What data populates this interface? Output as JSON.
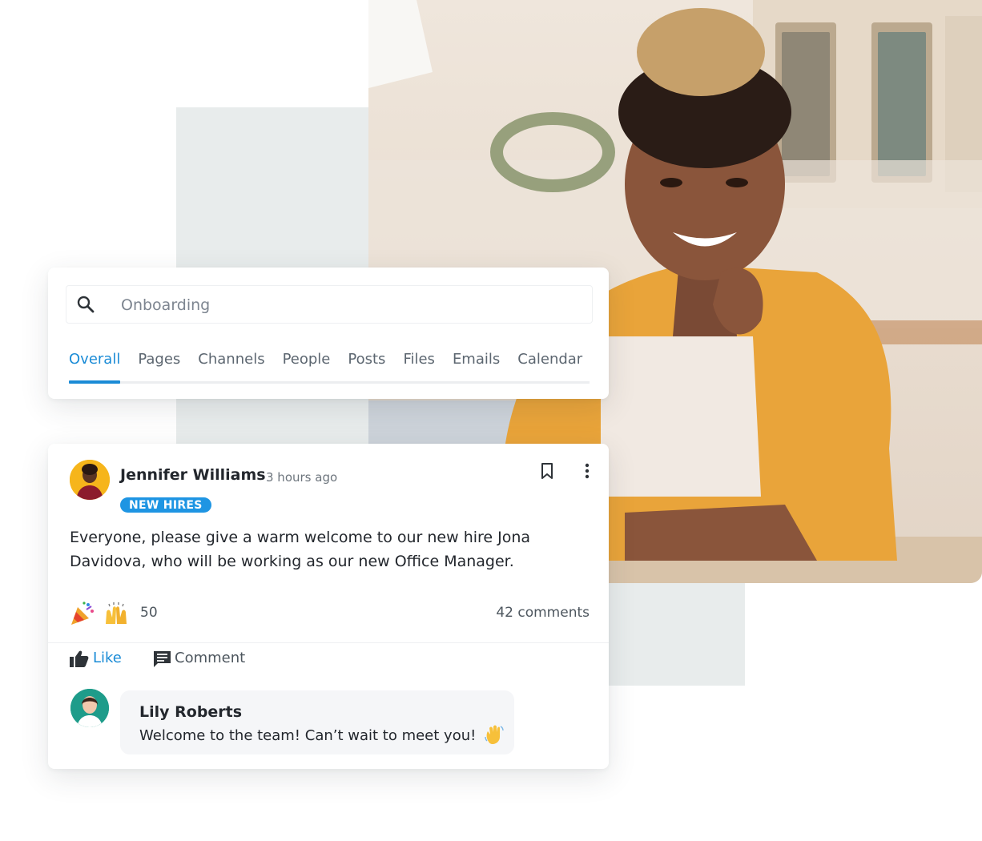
{
  "search": {
    "placeholder": "Onboarding",
    "tabs": [
      {
        "label": "Overall",
        "active": true
      },
      {
        "label": "Pages",
        "active": false
      },
      {
        "label": "Channels",
        "active": false
      },
      {
        "label": "People",
        "active": false
      },
      {
        "label": "Posts",
        "active": false
      },
      {
        "label": "Files",
        "active": false
      },
      {
        "label": "Emails",
        "active": false
      },
      {
        "label": "Calendar",
        "active": false
      }
    ]
  },
  "post": {
    "author": "Jennifer Williams",
    "time": "3 hours ago",
    "badge": "NEW HIRES",
    "body": "Everyone, please give a warm welcome to our new hire Jona Davidova, who will be working as our new Office Manager.",
    "reaction_emojis": [
      "party-popper",
      "raising-hands"
    ],
    "reaction_count": "50",
    "comments_count": "42 comments",
    "like_label": "Like",
    "comment_label": "Comment"
  },
  "comment": {
    "author": "Lily Roberts",
    "text": "Welcome to the team! Can’t wait to meet you!",
    "emoji": "waving-hand"
  },
  "colors": {
    "accent": "#1a8bd6",
    "badge": "#1e95e3",
    "text": "#23272d"
  }
}
